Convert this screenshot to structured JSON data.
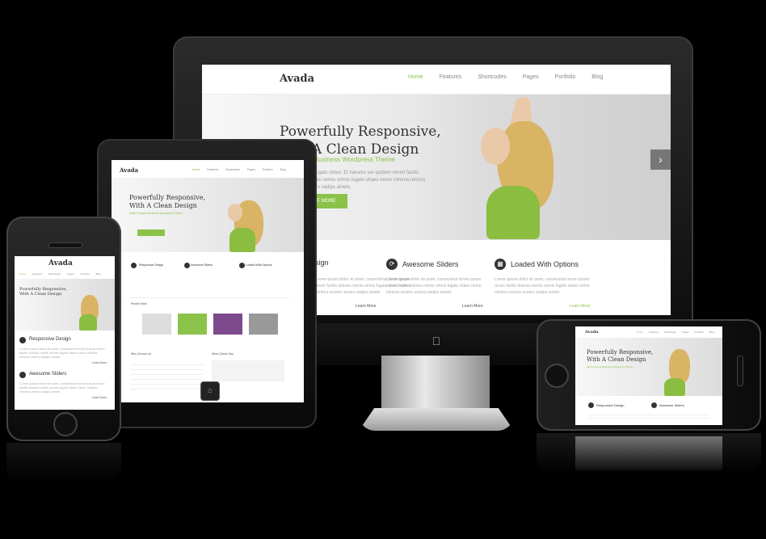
{
  "brand": {
    "logo": "Avada",
    "accent": "#8bc34a"
  },
  "nav": {
    "items": [
      "Home",
      "Features",
      "Shortcodes",
      "Pages",
      "Portfolio",
      "Blog"
    ]
  },
  "hero": {
    "title_line1": "Powerfully Responsive,",
    "title_line2": "With A Clean Design",
    "title_partial_line2": "A Clean Design",
    "subtitle": "Multi-Purpose Business Wordpress Theme",
    "subtitle_partial": "se Business Wordpress Theme",
    "paragraph_partial": "ose fugats untus. Et harums ser quidem rerum facilis dolores nemis omnis fugats vitaes nemo minima rerums unsers sadips amets.",
    "button_partial": "E MORE"
  },
  "features": [
    {
      "title": "Responsive Design",
      "title_partial": "sive Design",
      "icon": "screen-icon"
    },
    {
      "title": "Awesome Sliders",
      "icon": "slider-icon"
    },
    {
      "title": "Loaded With Options",
      "icon": "options-icon"
    }
  ],
  "feature_text": "Lorem ipsum dolor sit amet, consectetur lorem ipsum rerum facilis dolores nemis omnis fugats vitaes nemo minima rerums unsers sadips amets.",
  "learn_more": "Learn More",
  "tablet": {
    "recent_work": "Recent Work",
    "why_choose": "Why Choose Us",
    "what_clients": "What Clients Say"
  }
}
